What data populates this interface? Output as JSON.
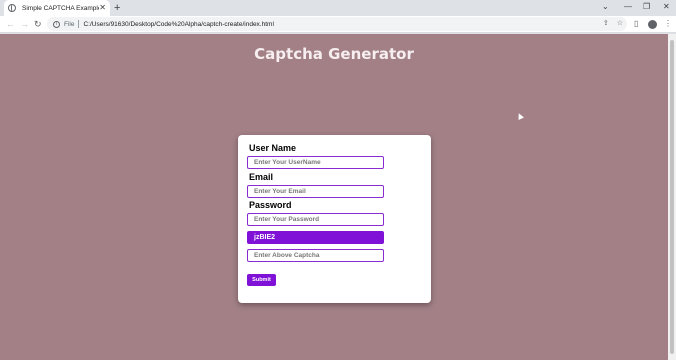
{
  "browser": {
    "tab_title": "Simple CAPTCHA Example",
    "scheme_label": "File",
    "url": "C:/Users/91630/Desktop/Code%20Alpha/captch-create/index.html"
  },
  "page": {
    "title": "Captcha Generator",
    "background_color": "#a28086",
    "accent_color": "#7f12d6"
  },
  "form": {
    "username_label": "User Name",
    "username_placeholder": "Enter Your UserName",
    "email_label": "Email",
    "email_placeholder": "Enter Your Email",
    "password_label": "Password",
    "password_placeholder": "Enter Your Password",
    "captcha_text": "jzBIE2",
    "captcha_placeholder": "Enter Above Captcha",
    "submit_label": "Submit"
  }
}
